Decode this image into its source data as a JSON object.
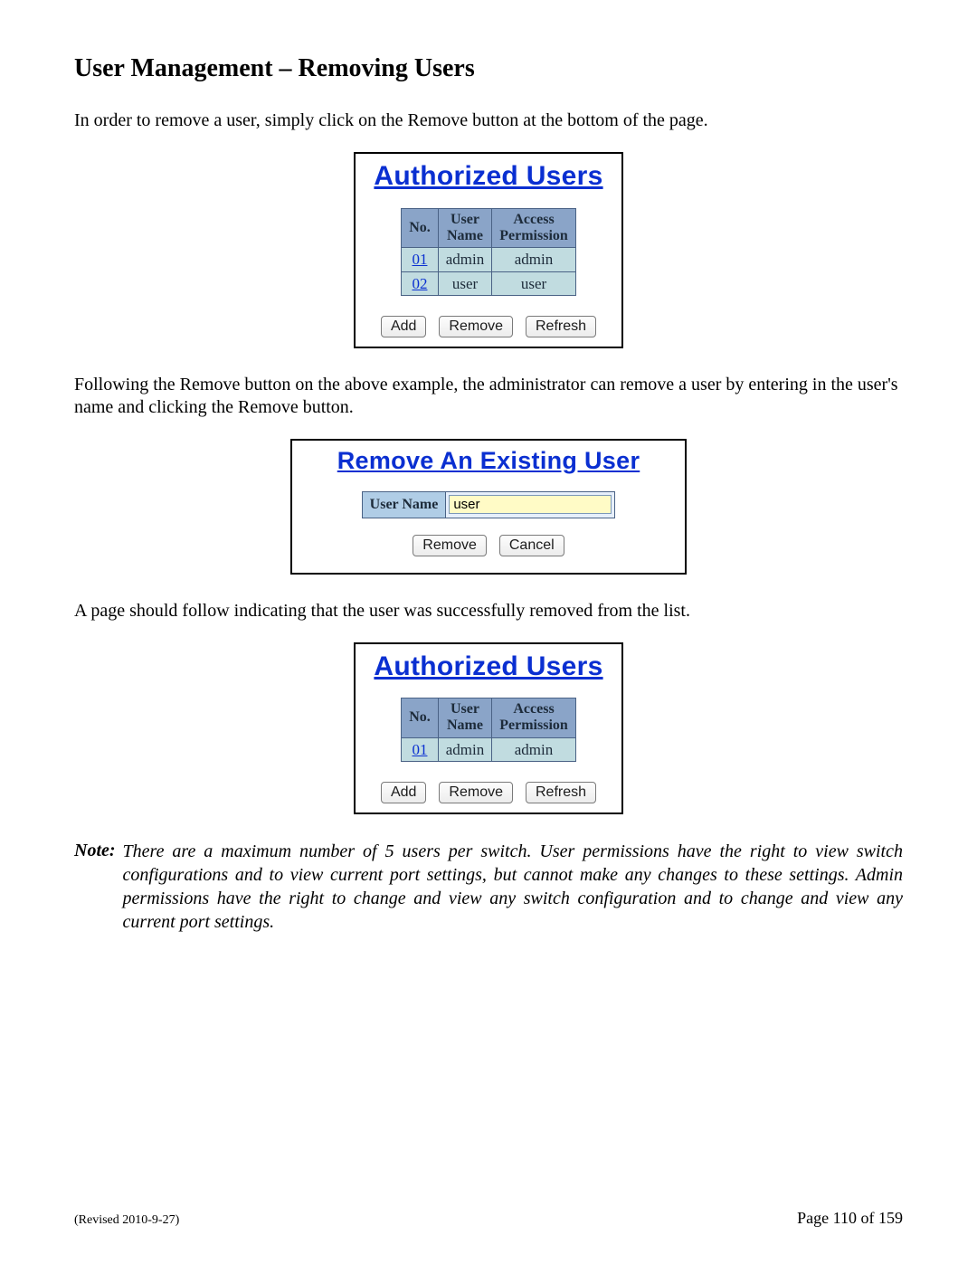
{
  "heading": "User Management – Removing Users",
  "para1": "In order to remove a user, simply click on the Remove button at the bottom of the page.",
  "para2": "Following the Remove button on the above example, the administrator can remove a user by entering in the user's name and clicking the Remove button.",
  "para3": "A page should follow indicating that the user was successfully removed from the list.",
  "note_label": "Note:",
  "note_text": "There are a maximum number of 5 users per switch.  User permissions have the right to view switch configurations and to view current port settings, but cannot make any changes to these settings.  Admin permissions have the right to change and view any switch configuration and to change and view any current port settings.",
  "footer": {
    "revised": "(Revised 2010-9-27)",
    "page": "Page 110 of 159"
  },
  "fig1": {
    "title": "Authorized Users",
    "headers": {
      "no": "No.",
      "name": "User\nName",
      "perm": "Access\nPermission"
    },
    "rows": [
      {
        "no": "01",
        "name": "admin",
        "perm": "admin"
      },
      {
        "no": "02",
        "name": "user",
        "perm": "user"
      }
    ],
    "buttons": {
      "add": "Add",
      "remove": "Remove",
      "refresh": "Refresh"
    }
  },
  "fig2": {
    "title": "Remove An Existing User",
    "label": "User Name",
    "value": "user",
    "buttons": {
      "remove": "Remove",
      "cancel": "Cancel"
    }
  },
  "fig3": {
    "title": "Authorized Users",
    "headers": {
      "no": "No.",
      "name": "User\nName",
      "perm": "Access\nPermission"
    },
    "rows": [
      {
        "no": "01",
        "name": "admin",
        "perm": "admin"
      }
    ],
    "buttons": {
      "add": "Add",
      "remove": "Remove",
      "refresh": "Refresh"
    }
  }
}
